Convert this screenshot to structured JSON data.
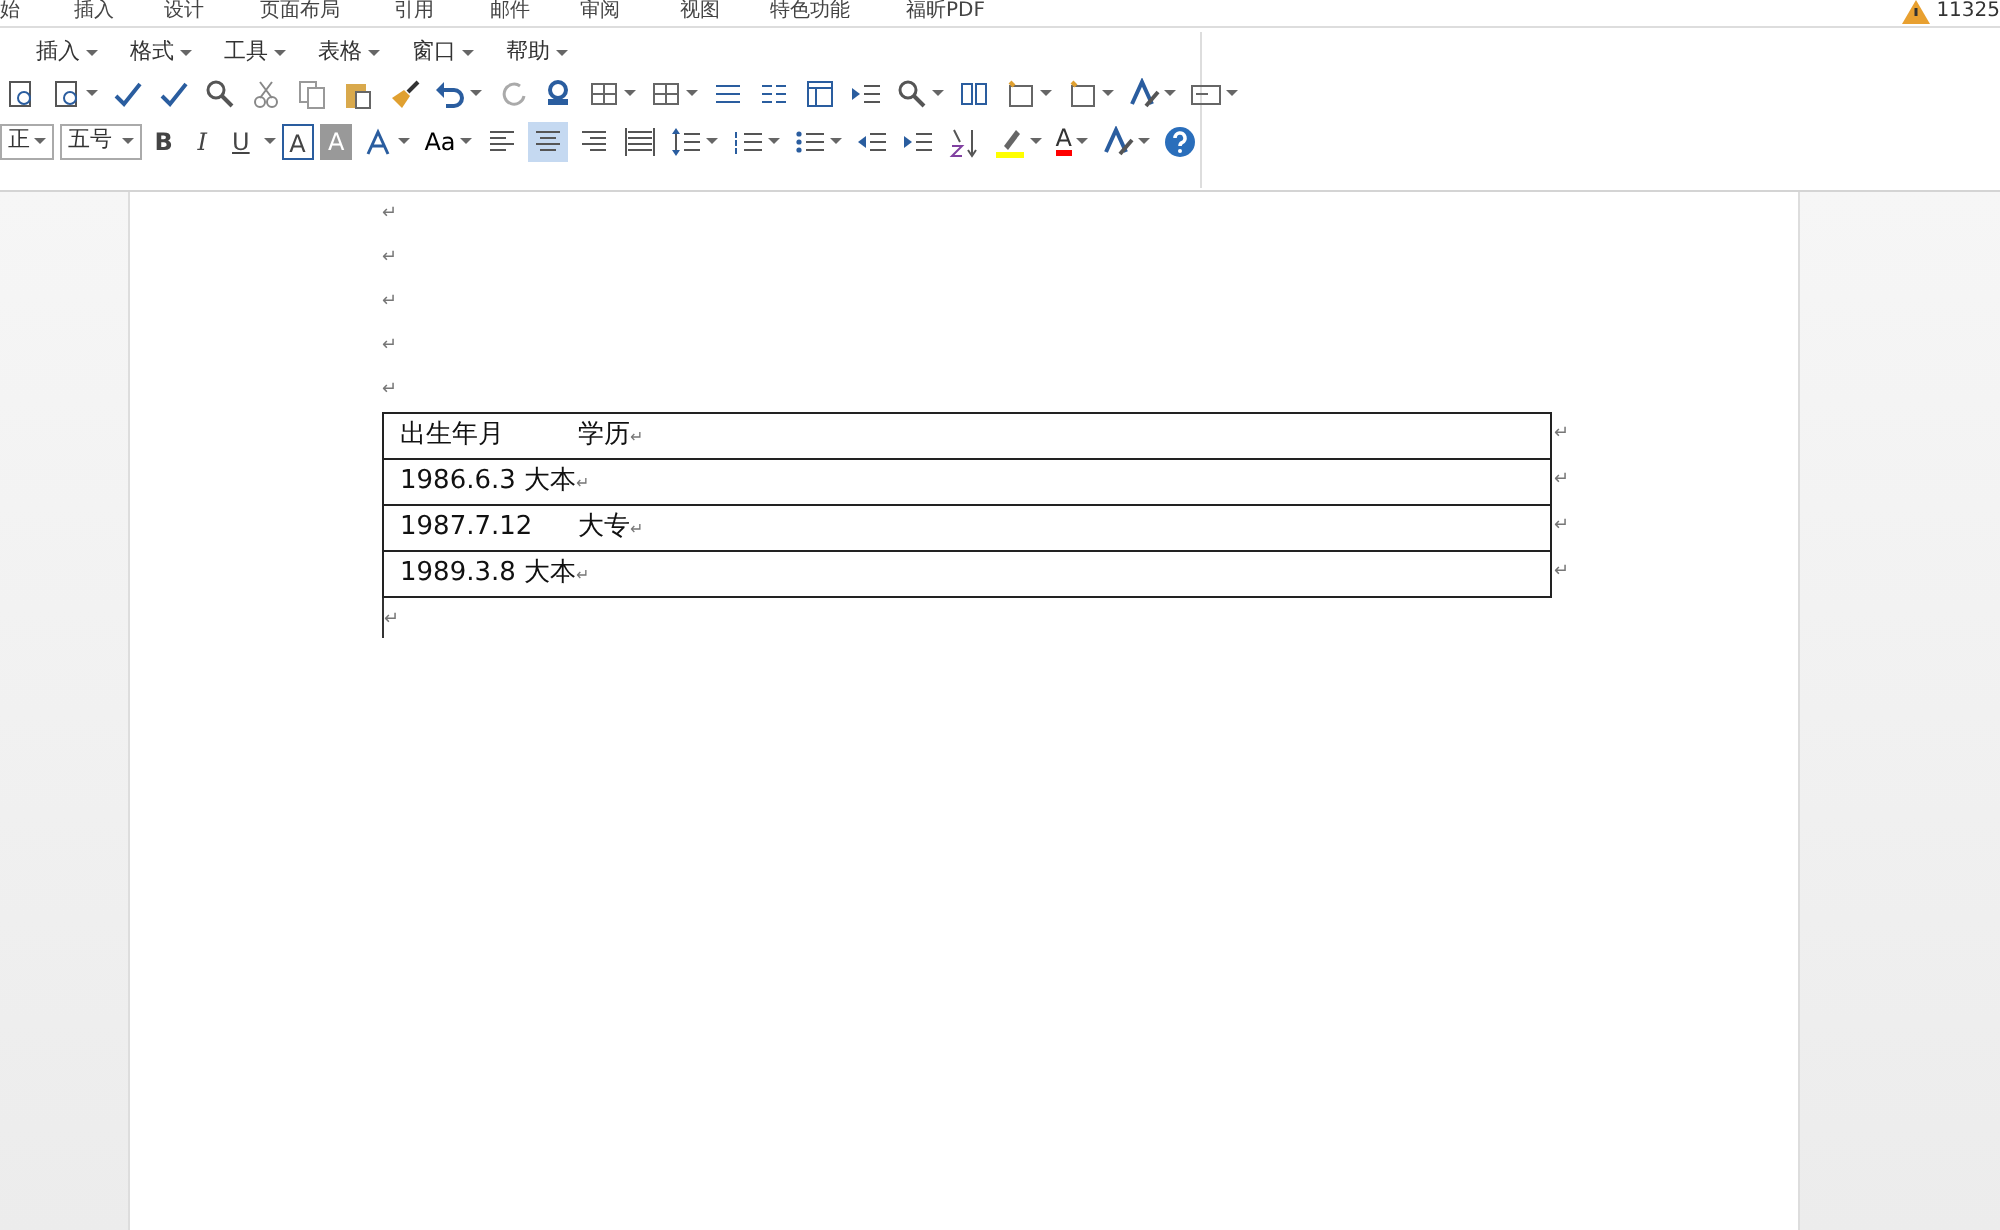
{
  "ribbon_tabs": [
    "始",
    "插入",
    "设计",
    "页面布局",
    "引用",
    "邮件",
    "审阅",
    "视图",
    "特色功能",
    "福昕PDF"
  ],
  "account": "11325",
  "menu": [
    "插入",
    "格式",
    "工具",
    "表格",
    "窗口",
    "帮助"
  ],
  "font_name": "正",
  "font_size": "五号",
  "text_buttons": [
    {
      "kind": "bold",
      "label": "B"
    },
    {
      "kind": "italic",
      "label": "I"
    },
    {
      "kind": "underline",
      "label": "U"
    },
    {
      "kind": "boxed",
      "label": "A"
    },
    {
      "kind": "shaded",
      "label": "A"
    }
  ],
  "case_button": "Aa",
  "alignment": [
    {
      "selected": false
    },
    {
      "selected": true
    },
    {
      "selected": false
    },
    {
      "selected": false
    }
  ],
  "font_color_button": "A",
  "document": {
    "empty_paragraphs": [
      "↵",
      "↵",
      "↵",
      "↵",
      "↵"
    ],
    "table_rows": [
      {
        "parts": [
          "出生年月",
          "学历"
        ],
        "end_mark": "↵",
        "row_mark": "↵"
      },
      {
        "parts": [
          "1986.6.3 大本"
        ],
        "end_mark": "↵",
        "row_mark": "↵"
      },
      {
        "parts": [
          "1987.7.12",
          "大专"
        ],
        "end_mark": "↵",
        "row_mark": "↵"
      },
      {
        "parts": [
          "1989.3.8 大本"
        ],
        "end_mark": "↵",
        "row_mark": "↵"
      }
    ],
    "last_paragraph": "↵"
  }
}
